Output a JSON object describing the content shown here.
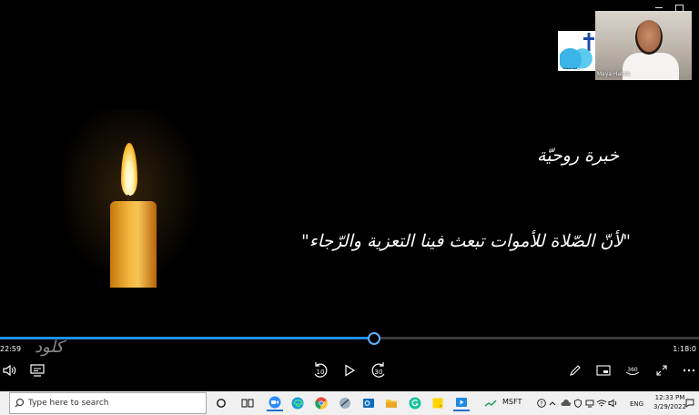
{
  "video": {
    "title_ar": "خبرة روحيّة",
    "quote_ar": "\"لأنّ الصّلاة للأموات تبعث فينا التعزية والرّجاء\""
  },
  "participant": {
    "name": "Maya Habre"
  },
  "logo": {
    "caption": "رعية سيدة"
  },
  "player": {
    "time_elapsed": "22:59",
    "time_total": "1:18:0",
    "progress": 0.535,
    "skip_back_label": "10",
    "skip_forward_label": "30",
    "watermark": "كلود",
    "accent": "#1f8ff0"
  },
  "taskbar": {
    "search_placeholder": "Type here to search",
    "stock_label": "MSFT",
    "language": "ENG",
    "time": "12:33 PM",
    "date": "3/29/2022",
    "icons": [
      "cortana-icon",
      "task-view-icon",
      "zoom-icon",
      "edge-icon",
      "chrome-icon",
      "mail-app-icon",
      "outlook-icon",
      "file-explorer-icon",
      "grammarly-icon",
      "sticky-notes-icon",
      "video-player-icon"
    ]
  }
}
